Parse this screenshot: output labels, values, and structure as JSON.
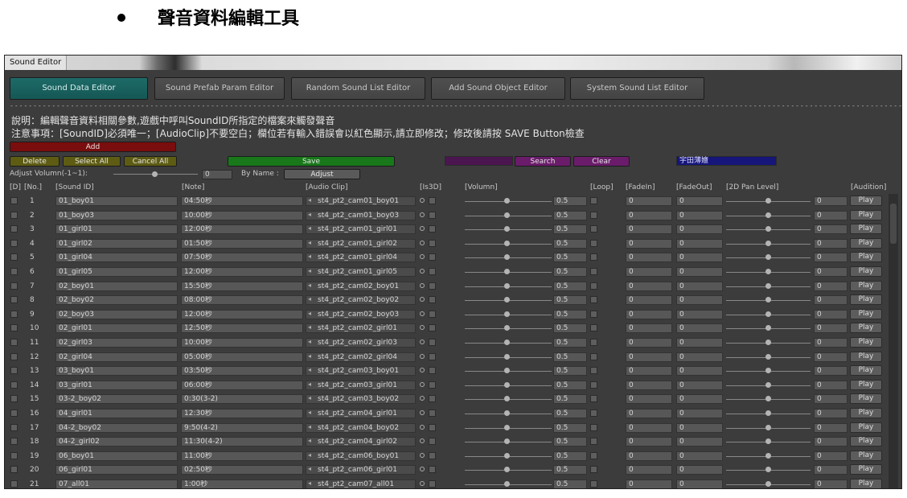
{
  "heading": "聲音資料編輯工具",
  "window": {
    "title": "Sound Editor",
    "tabs": [
      {
        "label": "Sound Data Editor",
        "active": true
      },
      {
        "label": "Sound Prefab Param Editor",
        "active": false
      },
      {
        "label": "Random Sound List Editor",
        "active": false
      },
      {
        "label": "Add Sound Object Editor",
        "active": false
      },
      {
        "label": "System Sound List Editor",
        "active": false
      }
    ],
    "separator": "--------------------------------------------------------------------------------------------------------------------------------------------------------------------------------------------------------------------------------------------------------------------------------------------------------------------",
    "desc_line1": "說明：編輯聲音資料相關參數,遊戲中呼叫SoundID所指定的檔案來觸發聲音",
    "desc_line2": "注意事項：[SoundID]必須唯一；[AudioClip]不要空白；欄位若有輸入錯誤會以紅色顯示,請立即修改；修改後請按 SAVE Button檢查",
    "toolbar": {
      "add": "Add",
      "delete": "Delete",
      "select_all": "Select All",
      "cancel_all": "Cancel All",
      "save": "Save",
      "search": "Search",
      "clear": "Clear",
      "font_label": "宇田薄嬗",
      "adjust_volume_label": "Adjust Volumn(-1~1):",
      "adjust_volume_value": "0",
      "by_name_label": "By Name :",
      "adjust": "Adjust"
    },
    "columns": {
      "d": "[D]",
      "no": "[No.]",
      "sound_id": "[Sound ID]",
      "note": "[Note]",
      "audio_clip": "[Audio Clip]",
      "is3d": "[Is3D]",
      "volume": "[Volumn]",
      "loop": "[Loop]",
      "fadein": "[FadeIn]",
      "fadeout": "[FadeOut]",
      "pan": "[2D Pan Level]",
      "audition": "[Audition]"
    },
    "play_label": "Play",
    "rows": [
      {
        "no": "1",
        "id": "01_boy01",
        "note": "04:50秒",
        "clip": "st4_pt2_cam01_boy01",
        "vol": "0.5",
        "fin": "0",
        "fout": "0",
        "pan": "0"
      },
      {
        "no": "2",
        "id": "01_boy03",
        "note": "10:00秒",
        "clip": "st4_pt2_cam01_boy03",
        "vol": "0.5",
        "fin": "0",
        "fout": "0",
        "pan": "0"
      },
      {
        "no": "3",
        "id": "01_girl01",
        "note": "12:00秒",
        "clip": "st4_pt2_cam01_girl01",
        "vol": "0.5",
        "fin": "0",
        "fout": "0",
        "pan": "0"
      },
      {
        "no": "4",
        "id": "01_girl02",
        "note": "01:50秒",
        "clip": "st4_pt2_cam01_girl02",
        "vol": "0.5",
        "fin": "0",
        "fout": "0",
        "pan": "0"
      },
      {
        "no": "5",
        "id": "01_girl04",
        "note": "07:50秒",
        "clip": "st4_pt2_cam01_girl04",
        "vol": "0.5",
        "fin": "0",
        "fout": "0",
        "pan": "0"
      },
      {
        "no": "6",
        "id": "01_girl05",
        "note": "12:00秒",
        "clip": "st4_pt2_cam01_girl05",
        "vol": "0.5",
        "fin": "0",
        "fout": "0",
        "pan": "0"
      },
      {
        "no": "7",
        "id": "02_boy01",
        "note": "15:50秒",
        "clip": "st4_pt2_cam02_boy01",
        "vol": "0.5",
        "fin": "0",
        "fout": "0",
        "pan": "0"
      },
      {
        "no": "8",
        "id": "02_boy02",
        "note": "08:00秒",
        "clip": "st4_pt2_cam02_boy02",
        "vol": "0.5",
        "fin": "0",
        "fout": "0",
        "pan": "0"
      },
      {
        "no": "9",
        "id": "02_boy03",
        "note": "12:00秒",
        "clip": "st4_pt2_cam02_boy03",
        "vol": "0.5",
        "fin": "0",
        "fout": "0",
        "pan": "0"
      },
      {
        "no": "10",
        "id": "02_girl01",
        "note": "12:50秒",
        "clip": "st4_pt2_cam02_girl01",
        "vol": "0.5",
        "fin": "0",
        "fout": "0",
        "pan": "0"
      },
      {
        "no": "11",
        "id": "02_girl03",
        "note": "10:00秒",
        "clip": "st4_pt2_cam02_girl03",
        "vol": "0.5",
        "fin": "0",
        "fout": "0",
        "pan": "0"
      },
      {
        "no": "12",
        "id": "02_girl04",
        "note": "05:00秒",
        "clip": "st4_pt2_cam02_girl04",
        "vol": "0.5",
        "fin": "0",
        "fout": "0",
        "pan": "0"
      },
      {
        "no": "13",
        "id": "03_boy01",
        "note": "03:50秒",
        "clip": "st4_pt2_cam03_boy01",
        "vol": "0.5",
        "fin": "0",
        "fout": "0",
        "pan": "0"
      },
      {
        "no": "14",
        "id": "03_girl01",
        "note": "06:00秒",
        "clip": "st4_pt2_cam03_girl01",
        "vol": "0.5",
        "fin": "0",
        "fout": "0",
        "pan": "0"
      },
      {
        "no": "15",
        "id": "03-2_boy02",
        "note": "0:30(3-2)",
        "clip": "st4_pt2_cam03_boy02",
        "vol": "0.5",
        "fin": "0",
        "fout": "0",
        "pan": "0"
      },
      {
        "no": "16",
        "id": "04_girl01",
        "note": "12:30秒",
        "clip": "st4_pt2_cam04_girl01",
        "vol": "0.5",
        "fin": "0",
        "fout": "0",
        "pan": "0"
      },
      {
        "no": "17",
        "id": "04-2_boy02",
        "note": "9:50(4-2)",
        "clip": "st4_pt2_cam04_boy02",
        "vol": "0.5",
        "fin": "0",
        "fout": "0",
        "pan": "0"
      },
      {
        "no": "18",
        "id": "04-2_girl02",
        "note": "11:30(4-2)",
        "clip": "st4_pt2_cam04_girl02",
        "vol": "0.5",
        "fin": "0",
        "fout": "0",
        "pan": "0"
      },
      {
        "no": "19",
        "id": "06_boy01",
        "note": "11:00秒",
        "clip": "st4_pt2_cam06_boy01",
        "vol": "0.5",
        "fin": "0",
        "fout": "0",
        "pan": "0"
      },
      {
        "no": "20",
        "id": "06_girl01",
        "note": "02:50秒",
        "clip": "st4_pt2_cam06_girl01",
        "vol": "0.5",
        "fin": "0",
        "fout": "0",
        "pan": "0"
      },
      {
        "no": "21",
        "id": "07_all01",
        "note": "1:00秒",
        "clip": "st4_pt2_cam07_all01",
        "vol": "0.5",
        "fin": "0",
        "fout": "0",
        "pan": "0"
      }
    ]
  }
}
